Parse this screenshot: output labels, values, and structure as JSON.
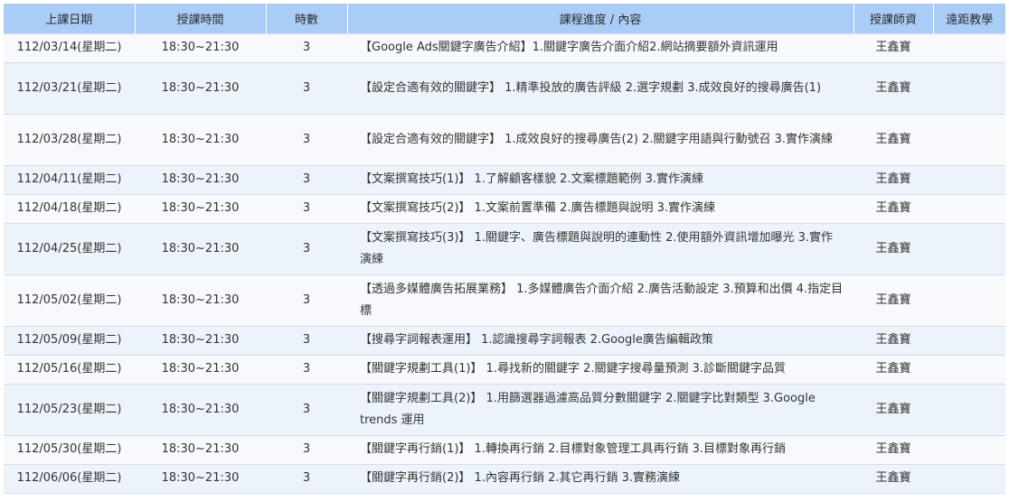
{
  "table": {
    "headers": [
      "上課日期",
      "授課時間",
      "時數",
      "課程進度 / 內容",
      "授課師資",
      "遠距教學"
    ],
    "rows": [
      {
        "date": "112/03/14(星期二)",
        "time": "18:30~21:30",
        "hours": "3",
        "content": "【Google Ads關鍵字廣告介紹】1.關鍵字廣告介面介紹2.網站摘要額外資訊運用",
        "teacher": "王鑫寶",
        "remote": ""
      },
      {
        "date": "112/03/21(星期二)",
        "time": "18:30~21:30",
        "hours": "3",
        "content": "【設定合適有效的關鍵字】 1.精準投放的廣告評級 2.選字規劃 3.成效良好的搜尋廣告(1)",
        "teacher": "王鑫寶",
        "remote": ""
      },
      {
        "date": "112/03/28(星期二)",
        "time": "18:30~21:30",
        "hours": "3",
        "content": "【設定合適有效的關鍵字】 1.成效良好的搜尋廣告(2) 2.關鍵字用語與行動號召 3.實作演練",
        "teacher": "王鑫寶",
        "remote": ""
      },
      {
        "date": "112/04/11(星期二)",
        "time": "18:30~21:30",
        "hours": "3",
        "content": "【文案撰寫技巧(1)】 1.了解顧客樣貌 2.文案標題範例 3.實作演練",
        "teacher": "王鑫寶",
        "remote": ""
      },
      {
        "date": "112/04/18(星期二)",
        "time": "18:30~21:30",
        "hours": "3",
        "content": "【文案撰寫技巧(2)】 1.文案前置準備 2.廣告標題與說明 3.實作演練",
        "teacher": "王鑫寶",
        "remote": ""
      },
      {
        "date": "112/04/25(星期二)",
        "time": "18:30~21:30",
        "hours": "3",
        "content": "【文案撰寫技巧(3)】 1.關鍵字、廣告標題與說明的連動性 2.使用額外資訊增加曝光 3.實作演練",
        "teacher": "王鑫寶",
        "remote": ""
      },
      {
        "date": "112/05/02(星期二)",
        "time": "18:30~21:30",
        "hours": "3",
        "content": "【透過多媒體廣告拓展業務】 1.多媒體廣告介面介紹 2.廣告活動設定 3.預算和出價 4.指定目標",
        "teacher": "王鑫寶",
        "remote": ""
      },
      {
        "date": "112/05/09(星期二)",
        "time": "18:30~21:30",
        "hours": "3",
        "content": "【搜尋字詞報表運用】 1.認識搜尋字詞報表 2.Google廣告編輯政策",
        "teacher": "王鑫寶",
        "remote": ""
      },
      {
        "date": "112/05/16(星期二)",
        "time": "18:30~21:30",
        "hours": "3",
        "content": "【關鍵字規劃工具(1)】 1.尋找新的關鍵字 2.關鍵字搜尋量預測 3.診斷關鍵字品質",
        "teacher": "王鑫寶",
        "remote": ""
      },
      {
        "date": "112/05/23(星期二)",
        "time": "18:30~21:30",
        "hours": "3",
        "content": "【關鍵字規劃工具(2)】 1.用篩選器過濾高品質分數關鍵字 2.關鍵字比對類型 3.Google trends 運用",
        "teacher": "王鑫寶",
        "remote": ""
      },
      {
        "date": "112/05/30(星期二)",
        "time": "18:30~21:30",
        "hours": "3",
        "content": "【關鍵字再行銷(1)】 1.轉換再行銷 2.目標對象管理工具再行銷 3.目標對象再行銷",
        "teacher": "王鑫寶",
        "remote": ""
      },
      {
        "date": "112/06/06(星期二)",
        "time": "18:30~21:30",
        "hours": "3",
        "content": "【關鍵字再行銷(2)】 1.內容再行銷 2.其它再行銷 3.實務演練",
        "teacher": "王鑫寶",
        "remote": ""
      }
    ]
  }
}
